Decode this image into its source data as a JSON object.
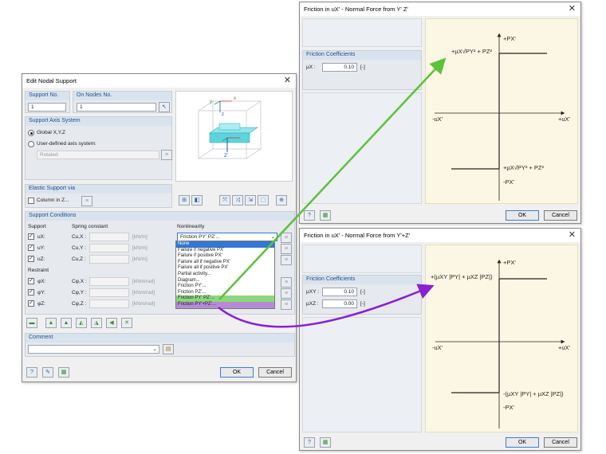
{
  "edit_dialog": {
    "title": "Edit Nodal Support",
    "support_no_label": "Support No.",
    "on_nodes_label": "On Nodes No.",
    "support_no": "1",
    "on_nodes": "1",
    "axis_system_label": "Support Axis System",
    "global_label": "Global X,Y,Z",
    "user_defined_label": "User-defined axis system:",
    "rotated_value": "Rotated",
    "elastic_label": "Elastic Support via",
    "column_label": "Column in Z...",
    "conditions_label": "Support Conditions",
    "support_col": "Support",
    "spring_col": "Spring constant",
    "nonlinearity_col": "Nonlinearity",
    "rows": [
      {
        "name": "uX:",
        "sym": "Cu,X :",
        "unit": "[kN/m]"
      },
      {
        "name": "uY:",
        "sym": "Cu,Y :",
        "unit": "[kN/m]"
      },
      {
        "name": "uZ:",
        "sym": "Cu,Z :",
        "unit": "[kN/m]"
      }
    ],
    "restraint_label": "Restraint",
    "restraint_rows": [
      {
        "name": "φX:",
        "sym": "Cφ,X :",
        "unit": "[kNm/rad]"
      },
      {
        "name": "φY:",
        "sym": "Cφ,Y :",
        "unit": "[kNm/rad]"
      },
      {
        "name": "φZ:",
        "sym": "Cφ,Z :",
        "unit": "[kNm/rad]"
      }
    ],
    "nonlinearity_value": "Friction PY' PZ'...",
    "dropdown_items": [
      "None",
      "Failure if negative PX'",
      "Failure if positive PX'",
      "Failure all if negative PX'",
      "Failure all if positive PX'",
      "Partial activity...",
      "Diagram...",
      "Friction PY'...",
      "Friction PZ'...",
      "Friction PY' PZ'...",
      "Friction PY'+PZ'..."
    ],
    "comment_label": "Comment",
    "ok": "OK",
    "cancel": "Cancel",
    "axis_labels": {
      "x": "x",
      "z": "z",
      "y": "y",
      "zp": "Z'"
    }
  },
  "friction_top": {
    "title": "Friction in uX' - Normal Force from Y' Z'",
    "coef_label": "Friction Coefficients",
    "mu_x_label": "µX :",
    "mu_x_value": "0.10",
    "unit": "[-]",
    "graph": {
      "p_plus": "+PX'",
      "p_minus": "-PX'",
      "u_plus": "+uX'",
      "u_minus": "-uX'",
      "upper_formula": "+µX√PY² + PZ²",
      "lower_formula": "+µX√PY² + PZ²"
    },
    "ok": "OK",
    "cancel": "Cancel"
  },
  "friction_bottom": {
    "title": "Friction in uX' - Normal Force from Y'+Z'",
    "coef_label": "Friction Coefficients",
    "mu_xy_label": "µXY :",
    "mu_xy_value": "0.10",
    "mu_xz_label": "µXZ :",
    "mu_xz_value": "0.00",
    "unit": "[-]",
    "graph": {
      "p_plus": "+PX'",
      "p_minus": "-PX'",
      "u_plus": "+uX'",
      "u_minus": "-uX'",
      "upper_formula": "+(µXY |PY| + µXZ |PZ|)",
      "lower_formula": "-(µXY |PY| + µXZ |PZ|)"
    },
    "ok": "OK",
    "cancel": "Cancel"
  },
  "colors": {
    "green_arrow": "#5cc23a",
    "purple_arrow": "#8a1fd6",
    "selection": "#3278d4"
  }
}
